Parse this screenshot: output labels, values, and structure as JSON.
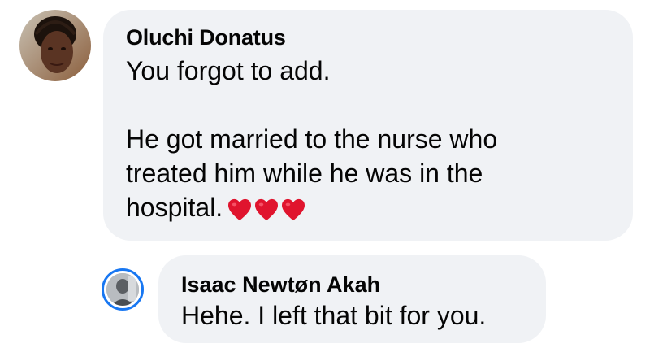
{
  "comment": {
    "author": "Oluchi Donatus",
    "lines": [
      "You forgot to add.",
      "He got married to the nurse who",
      "treated him while he was in the",
      "hospital."
    ],
    "emoji": [
      "heart-emoji",
      "heart-emoji",
      "heart-emoji"
    ]
  },
  "reply": {
    "author": "Isaac Newtøn Akah",
    "text": "Hehe. I left that bit for you."
  },
  "colors": {
    "bubble": "#f0f2f5",
    "text": "#050505",
    "avatar_ring": "#1877f2",
    "heart": "#e0142e"
  }
}
